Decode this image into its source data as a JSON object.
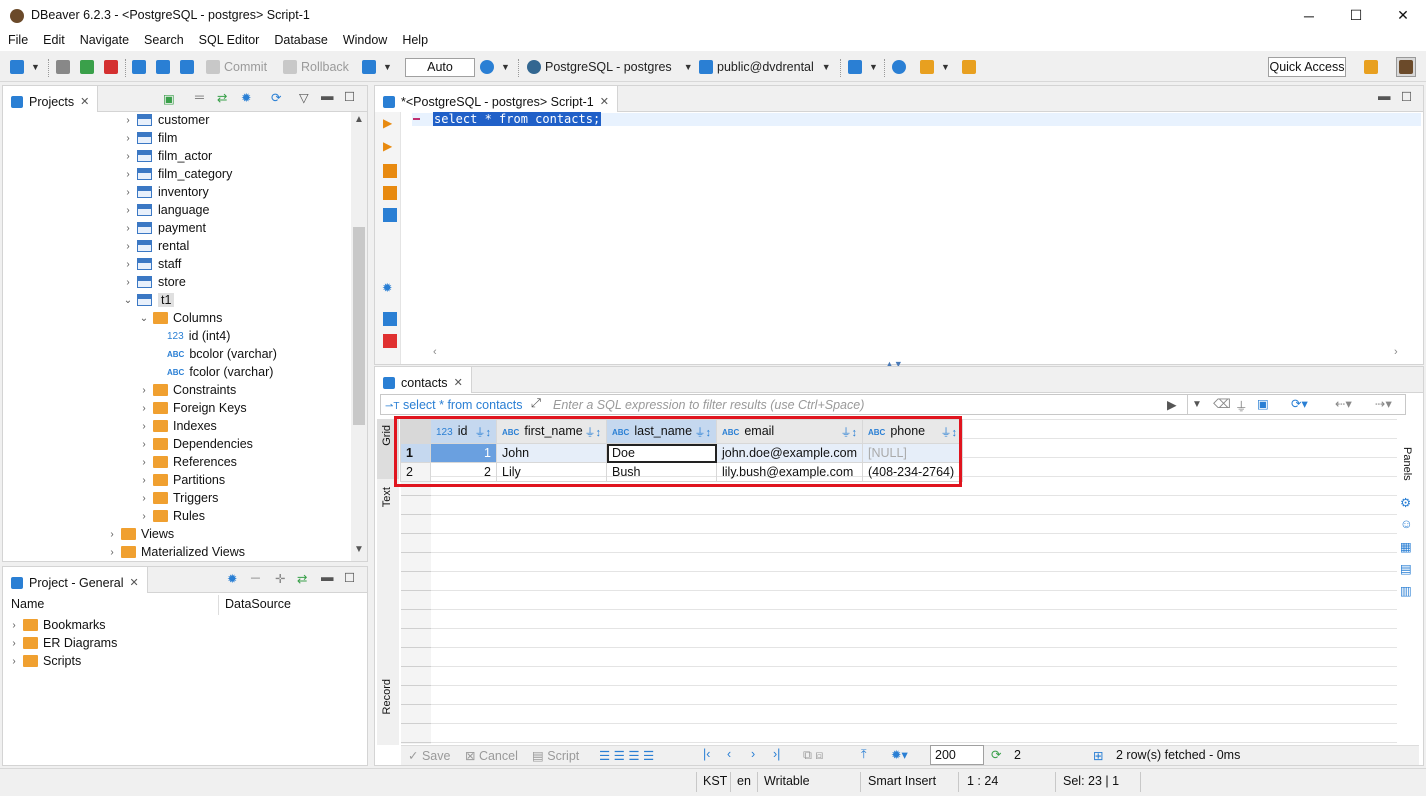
{
  "window": {
    "title": "DBeaver 6.2.3 - <PostgreSQL - postgres> Script-1",
    "minimize": "─",
    "maximize": "☐",
    "close": "✕"
  },
  "menu": [
    "File",
    "Edit",
    "Navigate",
    "Search",
    "SQL Editor",
    "Database",
    "Window",
    "Help"
  ],
  "toolbar": {
    "commit": "Commit",
    "rollback": "Rollback",
    "mode": "Auto",
    "connection": "PostgreSQL - postgres",
    "schema": "public@dvdrental",
    "quick_access": "Quick Access"
  },
  "projects": {
    "tab": "Projects",
    "tables": [
      "customer",
      "film",
      "film_actor",
      "film_category",
      "inventory",
      "language",
      "payment",
      "rental",
      "staff",
      "store"
    ],
    "selected_table": "t1",
    "columns_folder": "Columns",
    "columns": [
      {
        "type": "123",
        "label": "id (int4)"
      },
      {
        "type": "ABC",
        "label": "bcolor (varchar)"
      },
      {
        "type": "ABC",
        "label": "fcolor (varchar)"
      }
    ],
    "folders": [
      "Constraints",
      "Foreign Keys",
      "Indexes",
      "Dependencies",
      "References",
      "Partitions",
      "Triggers",
      "Rules"
    ],
    "views": "Views",
    "mviews": "Materialized Views"
  },
  "project_general": {
    "tab": "Project - General",
    "col_name": "Name",
    "col_ds": "DataSource",
    "items": [
      "Bookmarks",
      "ER Diagrams",
      "Scripts"
    ]
  },
  "editor": {
    "tab": "*<PostgreSQL - postgres> Script-1",
    "sql": "select * from contacts;"
  },
  "results": {
    "tab": "contacts",
    "query_label": "select * from contacts",
    "filter_placeholder": "Enter a SQL expression to filter results (use Ctrl+Space)",
    "side_tabs": {
      "grid": "Grid",
      "text": "Text",
      "record": "Record"
    },
    "panels": "Panels",
    "columns": [
      {
        "type": "123",
        "name": "id"
      },
      {
        "type": "ABC",
        "name": "first_name"
      },
      {
        "type": "ABC",
        "name": "last_name"
      },
      {
        "type": "ABC",
        "name": "email"
      },
      {
        "type": "ABC",
        "name": "phone"
      }
    ],
    "rows": [
      {
        "n": "1",
        "cells": [
          "1",
          "John",
          "Doe",
          "john.doe@example.com",
          "[NULL]"
        ]
      },
      {
        "n": "2",
        "cells": [
          "2",
          "Lily",
          "Bush",
          "lily.bush@example.com",
          "(408-234-2764)"
        ]
      }
    ],
    "bottom": {
      "save": "Save",
      "cancel": "Cancel",
      "script": "Script",
      "fetch_size": "200",
      "refresh_count": "2",
      "status": "2 row(s) fetched - 0ms"
    }
  },
  "statusbar": {
    "tz": "KST",
    "lang": "en",
    "mode": "Writable",
    "insert": "Smart Insert",
    "pos": "1 : 24",
    "sel": "Sel: 23 | 1"
  },
  "colors": {
    "highlight_border": "#e0141e",
    "selection": "#1f5fbf",
    "accent": "#2a7fd4"
  }
}
